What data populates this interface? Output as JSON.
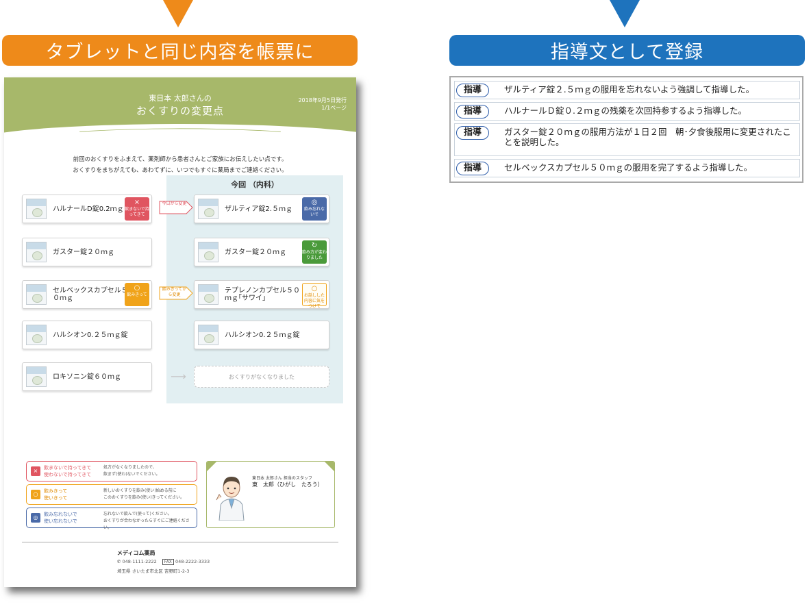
{
  "banners": {
    "left": "タブレットと同じ内容を帳票に",
    "right": "指導文として登録"
  },
  "sheet": {
    "patient_line": "東日本 太郎さんの",
    "title": "おくすりの変更点",
    "date": "2018年9月5日発行",
    "page": "1/1ページ",
    "intro1": "前回のおくすりをふまえて、薬剤師から患者さんとご家族にお伝えしたい点です。",
    "intro2": "おくすりをまちがえても、あわてずに、いつでもすぐに薬局までご連絡ください。",
    "current_header": "今回 （内科）",
    "previous": [
      {
        "name": "ハルナールD錠0.2ｍｇ",
        "tag": "飲まないで持ってきて",
        "tag_icon": "×"
      },
      {
        "name": "ガスター錠２０ｍｇ"
      },
      {
        "name": "セルベックスカプセル５０ｍｇ",
        "tag": "飲みきって",
        "tag_icon": "○"
      },
      {
        "name": "ハルシオン0.２５ｍｇ錠"
      },
      {
        "name": "ロキソニン錠６０ｍｇ"
      }
    ],
    "arrows": {
      "change": "今日から変更",
      "finish": "飲みきってから変更"
    },
    "current": [
      {
        "name": "ザルティア錠2.５ｍｇ",
        "tag": "飲み忘れないで",
        "tag_icon": "◎"
      },
      {
        "name": "ガスター錠２０ｍｇ",
        "tag": "飲み方が変わりました",
        "tag_icon": "↻"
      },
      {
        "name": "テプレノンカプセル５０ｍｇ｢サワイ｣",
        "tag": "お話しした内容に気をつけて",
        "tag_icon": "○"
      },
      {
        "name": "ハルシオン0.２５ｍｇ錠"
      }
    ],
    "empty_slot": "おくすりがなくなりました",
    "legend": [
      {
        "icon": "×",
        "label1": "飲まないで持ってきて",
        "label2": "使わないで持ってきて",
        "desc1": "処方がなくなりましたので、",
        "desc2": "飲まず(使わ)ないでください。"
      },
      {
        "icon": "○",
        "label1": "飲みきって",
        "label2": "使いきって",
        "desc1": "新しいおくすりを飲み(使い)始める前に",
        "desc2": "このおくすりを飲み(使い)きってください。"
      },
      {
        "icon": "◎",
        "label1": "飲み忘れないで",
        "label2": "使い忘れないで",
        "desc1": "忘れないで飲んで(使って)ください。",
        "desc2": "おくすりが合わなかったらすぐにご連絡ください。"
      }
    ],
    "staff_role": "東日本 太郎さん 担当のスタッフ",
    "staff_name": "東　太郎（ひがし　たろう）",
    "pharmacy": {
      "name": "メディコム薬局",
      "tel": "048-1111-2222",
      "fax_label": "FAX",
      "fax": "048-2222-3333",
      "address": "埼玉県 さいたま市北区 吉野町1-2-3"
    }
  },
  "guidance": {
    "pill_label": "指導",
    "rows": [
      "ザルティア錠２.５ｍｇの服用を忘れないよう強調して指導した。",
      "ハルナールＤ錠０.２ｍｇの残薬を次回持参するよう指導した。",
      "ガスター錠２０ｍｇの服用方法が１日２回　朝･夕食後服用に変更されたことを説明した。",
      "セルベックスカプセル５０ｍｇの服用を完了するよう指導した。"
    ]
  },
  "colors": {
    "orange": "#ee8a1a",
    "blue": "#1e73bd",
    "header_green": "#a7b86a",
    "red_tag": "#e05560"
  }
}
